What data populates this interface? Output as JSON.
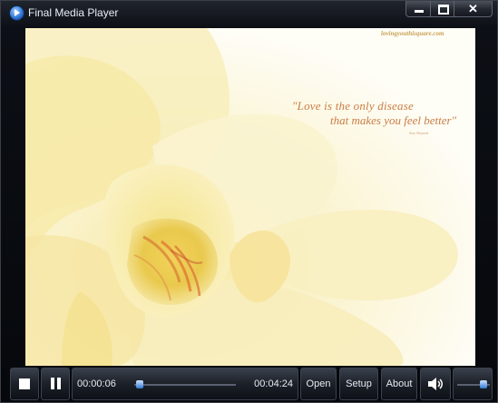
{
  "window": {
    "title": "Final Media Player",
    "close_glyph": "✕"
  },
  "video": {
    "watermark": "lovingyouthisquare.com",
    "quote_line1": "\"Love is the only disease",
    "quote_line2": "that makes you feel better\"",
    "quote_author": "Sam Shepard"
  },
  "controls": {
    "time_current": "00:00:06",
    "time_total": "00:04:24",
    "seek_fraction": 0.023,
    "volume_fraction": 0.9,
    "open_label": "Open",
    "setup_label": "Setup",
    "about_label": "About"
  },
  "icons": {
    "app": "app-icon",
    "stop": "stop-icon",
    "pause": "pause-icon",
    "volume": "speaker-icon"
  },
  "colors": {
    "accent": "#2f78d6",
    "quote": "#c97d45"
  }
}
